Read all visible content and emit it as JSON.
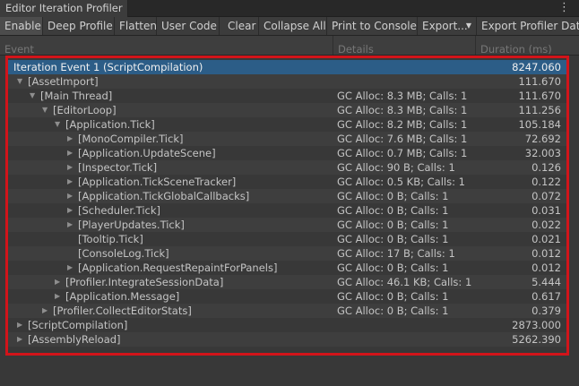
{
  "window": {
    "title": "Editor Iteration Profiler"
  },
  "toolbar": {
    "buttons": [
      "Enable",
      "Deep Profile",
      "Flatten",
      "User Code",
      "Clear",
      "Collapse All",
      "Print to Console",
      "Export...",
      "Export Profiler Data"
    ]
  },
  "columns": {
    "event": "Event",
    "details": "Details",
    "duration": "Duration (ms)"
  },
  "tree": {
    "rows": [
      {
        "name": "Iteration Event 1 (ScriptCompilation)",
        "details": "",
        "duration": "8247.060"
      },
      {
        "name": "[AssetImport]",
        "details": "",
        "duration": "111.670"
      },
      {
        "name": "[Main Thread]",
        "details": "GC Alloc: 8.3 MB; Calls: 1",
        "duration": "111.670"
      },
      {
        "name": "[EditorLoop]",
        "details": "GC Alloc: 8.3 MB; Calls: 1",
        "duration": "111.256"
      },
      {
        "name": "[Application.Tick]",
        "details": "GC Alloc: 8.2 MB; Calls: 1",
        "duration": "105.184"
      },
      {
        "name": "[MonoCompiler.Tick]",
        "details": "GC Alloc: 7.6 MB; Calls: 1",
        "duration": "72.692"
      },
      {
        "name": "[Application.UpdateScene]",
        "details": "GC Alloc: 0.7 MB; Calls: 1",
        "duration": "32.003"
      },
      {
        "name": "[Inspector.Tick]",
        "details": "GC Alloc: 90 B; Calls: 1",
        "duration": "0.126"
      },
      {
        "name": "[Application.TickSceneTracker]",
        "details": "GC Alloc: 0.5 KB; Calls: 1",
        "duration": "0.122"
      },
      {
        "name": "[Application.TickGlobalCallbacks]",
        "details": "GC Alloc: 0 B; Calls: 1",
        "duration": "0.072"
      },
      {
        "name": "[Scheduler.Tick]",
        "details": "GC Alloc: 0 B; Calls: 1",
        "duration": "0.031"
      },
      {
        "name": "[PlayerUpdates.Tick]",
        "details": "GC Alloc: 0 B; Calls: 1",
        "duration": "0.022"
      },
      {
        "name": "[Tooltip.Tick]",
        "details": "GC Alloc: 0 B; Calls: 1",
        "duration": "0.021"
      },
      {
        "name": "[ConsoleLog.Tick]",
        "details": "GC Alloc: 17 B; Calls: 1",
        "duration": "0.012"
      },
      {
        "name": "[Application.RequestRepaintForPanels]",
        "details": "GC Alloc: 0 B; Calls: 1",
        "duration": "0.012"
      },
      {
        "name": "[Profiler.IntegrateSessionData]",
        "details": "GC Alloc: 46.1 KB; Calls: 1",
        "duration": "5.444"
      },
      {
        "name": "[Application.Message]",
        "details": "GC Alloc: 0 B; Calls: 1",
        "duration": "0.617"
      },
      {
        "name": "[Profiler.CollectEditorStats]",
        "details": "GC Alloc: 0 B; Calls: 1",
        "duration": "0.379"
      },
      {
        "name": "[ScriptCompilation]",
        "details": "",
        "duration": "2873.000"
      },
      {
        "name": "[AssemblyReload]",
        "details": "",
        "duration": "5262.390"
      }
    ]
  },
  "colors": {
    "selection": "#2c5d87",
    "highlight_box": "#d2141a"
  }
}
